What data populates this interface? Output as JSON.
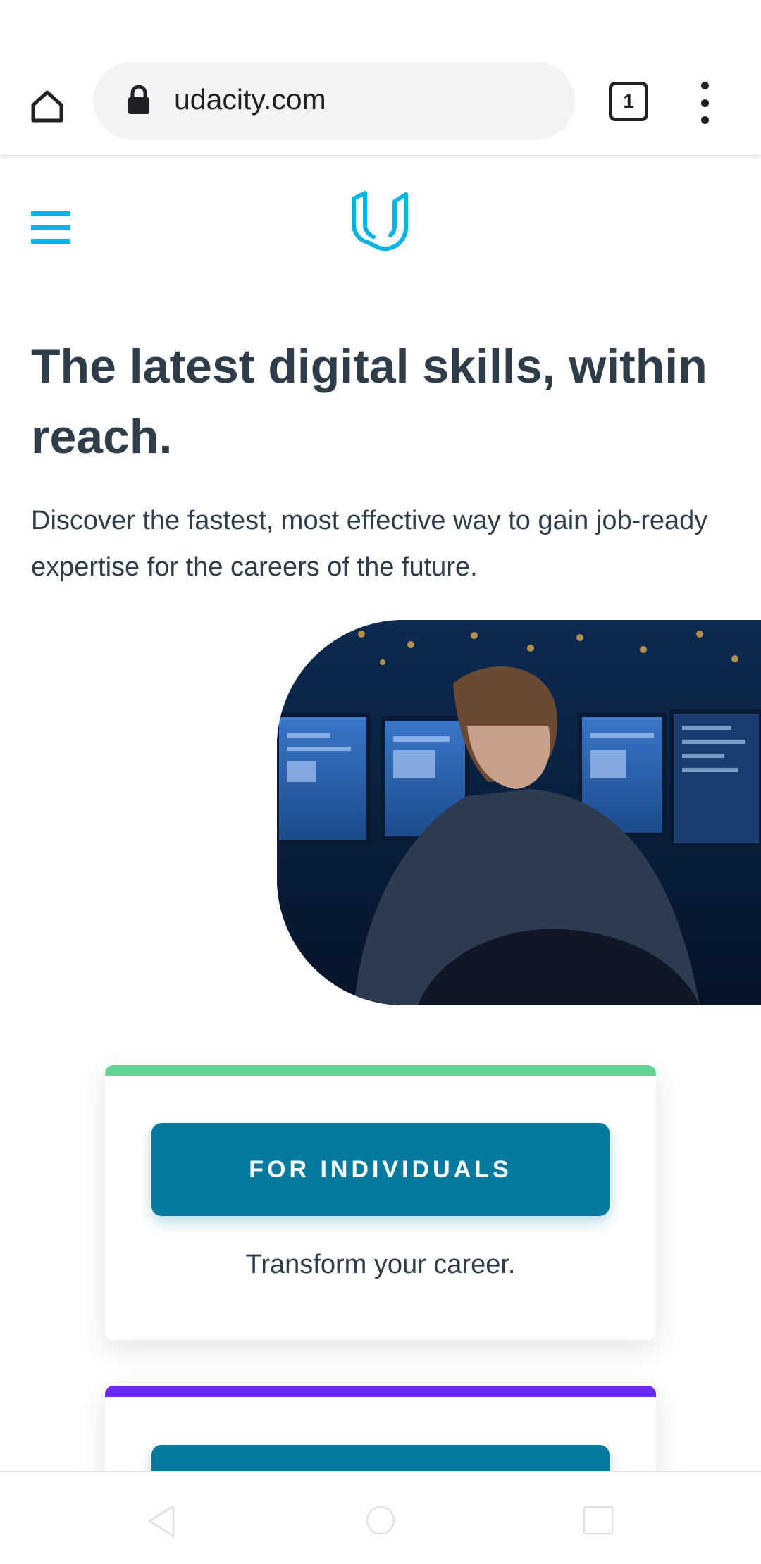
{
  "browser": {
    "url": "udacity.com",
    "tab_count": "1"
  },
  "header": {
    "logo": "udacity-logo"
  },
  "hero": {
    "title": "The latest digital skills, within reach.",
    "subtitle": "Discover the fastest, most effective way to gain job-ready expertise for the careers of the future."
  },
  "cards": [
    {
      "button_label": "FOR INDIVIDUALS",
      "description": "Transform your career.",
      "accent_color": "#62d293"
    },
    {
      "button_label": "",
      "description": "",
      "accent_color": "#6b2bf0"
    }
  ],
  "colors": {
    "brand": "#02b3e4",
    "button": "#037a9e",
    "text": "#2e3d49"
  }
}
